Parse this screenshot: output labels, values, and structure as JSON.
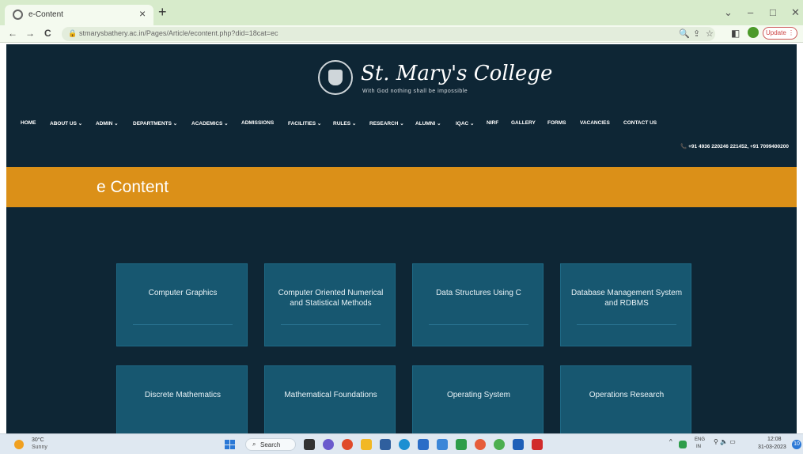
{
  "browser": {
    "tab_title": "e-Content",
    "tab_close": "×",
    "new_tab": "+",
    "win_minimize_chevron": "⌄",
    "win_minimize": "–",
    "win_maximize": "□",
    "win_close": "✕",
    "back": "←",
    "forward": "→",
    "reload": "C",
    "lock": "🔒",
    "url": "stmarysbathery.ac.in/Pages/Article/econtent.php?did=18cat=ec",
    "zoom_icon": "🔍",
    "share_icon": "⇪",
    "star_icon": "☆",
    "sidepanel_icon": "◧",
    "update_label": "Update",
    "update_menu": "⋮"
  },
  "site": {
    "college_name": "St. Mary's College",
    "motto": "With God nothing shall be impossible",
    "menu": [
      "HOME",
      "ABOUT US ⌄",
      "ADMIN ⌄",
      "DEPARTMENTS ⌄",
      "ACADEMICS ⌄",
      "ADMISSIONS",
      "FACILITIES ⌄",
      "RULES ⌄",
      "RESEARCH ⌄",
      "ALUMNI ⌄",
      "IQAC ⌄",
      "NIRF",
      "GALLERY",
      "FORMS",
      "VACANCIES",
      "CONTACT US"
    ],
    "contact": "📞 +91 4936 220246 221452, +91 7099400200",
    "banner_title": "e Content"
  },
  "cards": [
    "Computer Graphics",
    "Computer Oriented Numerical and Statistical Methods",
    "Data Structures Using C",
    "Database Management System and RDBMS",
    "Discrete Mathematics",
    "Mathematical Foundations",
    "Operating System",
    "Operations Research"
  ],
  "taskbar": {
    "weather_temp": "30°C",
    "weather_desc": "Sunny",
    "search_glyph": "⌕",
    "search_label": "Search",
    "tray_chevron": "^",
    "lang_1": "ENG",
    "lang_2": "IN",
    "wifi_sound_battery": "⚲ 🔈 ▭",
    "time": "12:08",
    "date": "31-03-2023",
    "notifications": "10"
  },
  "colors": {
    "page_bg": "#0e2635",
    "banner": "#db9018",
    "card": "#175770"
  }
}
